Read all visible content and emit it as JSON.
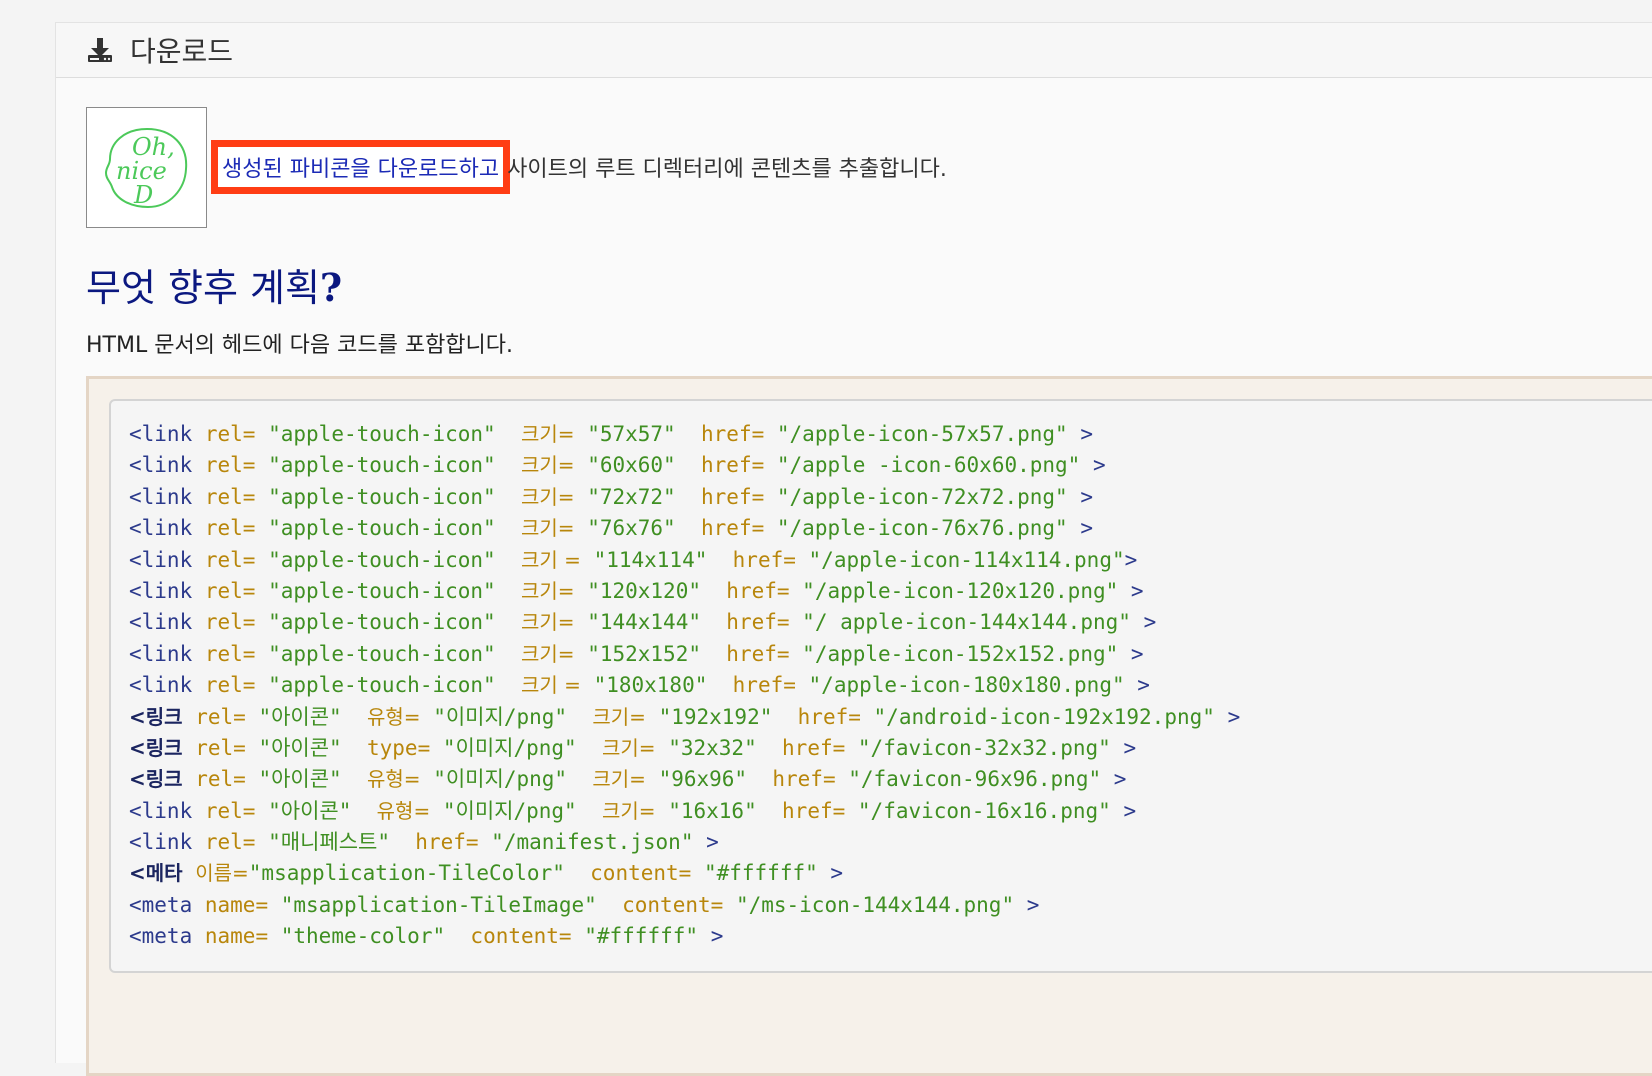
{
  "header": {
    "icon": "download-icon",
    "title": "다운로드"
  },
  "intro": {
    "link_text": "생성된 파비콘을 다운로드하고",
    "rest_text": " 사이트의 루트 디렉터리에 콘텐츠를 추출합니다."
  },
  "favicon_preview": {
    "icon": "oh-nice-d-logo",
    "logo_text": "Oh, nice D",
    "color": "#4cc95a"
  },
  "section": {
    "heading": "무엇 향후 계획",
    "heading_mark": "?",
    "description": "HTML 문서의 헤드에 다음 코드를 포함합니다."
  },
  "code_lines": [
    [
      [
        "tg",
        "<link"
      ],
      [
        "sp",
        " "
      ],
      [
        "at",
        "rel="
      ],
      [
        "sp",
        " "
      ],
      [
        "vl",
        "\"apple-touch-icon\""
      ],
      [
        "sp",
        "  "
      ],
      [
        "atk",
        "크기="
      ],
      [
        "sp",
        " "
      ],
      [
        "vl",
        "\"57x57\""
      ],
      [
        "sp",
        "  "
      ],
      [
        "at",
        "href="
      ],
      [
        "sp",
        " "
      ],
      [
        "vl",
        "\"/apple-icon-57x57.png\""
      ],
      [
        "sp",
        " "
      ],
      [
        "br",
        ">"
      ]
    ],
    [
      [
        "tg",
        "<link"
      ],
      [
        "sp",
        " "
      ],
      [
        "at",
        "rel="
      ],
      [
        "sp",
        " "
      ],
      [
        "vl",
        "\"apple-touch-icon\""
      ],
      [
        "sp",
        "  "
      ],
      [
        "atk",
        "크기="
      ],
      [
        "sp",
        " "
      ],
      [
        "vl",
        "\"60x60\""
      ],
      [
        "sp",
        "  "
      ],
      [
        "at",
        "href="
      ],
      [
        "sp",
        " "
      ],
      [
        "vl",
        "\"/apple -icon-60x60.png\""
      ],
      [
        "sp",
        " "
      ],
      [
        "br",
        ">"
      ]
    ],
    [
      [
        "tg",
        "<link"
      ],
      [
        "sp",
        " "
      ],
      [
        "at",
        "rel="
      ],
      [
        "sp",
        " "
      ],
      [
        "vl",
        "\"apple-touch-icon\""
      ],
      [
        "sp",
        "  "
      ],
      [
        "atk",
        "크기="
      ],
      [
        "sp",
        " "
      ],
      [
        "vl",
        "\"72x72\""
      ],
      [
        "sp",
        "  "
      ],
      [
        "at",
        "href="
      ],
      [
        "sp",
        " "
      ],
      [
        "vl",
        "\"/apple-icon-72x72.png\""
      ],
      [
        "sp",
        " "
      ],
      [
        "br",
        ">"
      ]
    ],
    [
      [
        "tg",
        "<link"
      ],
      [
        "sp",
        " "
      ],
      [
        "at",
        "rel="
      ],
      [
        "sp",
        " "
      ],
      [
        "vl",
        "\"apple-touch-icon\""
      ],
      [
        "sp",
        "  "
      ],
      [
        "atk",
        "크기="
      ],
      [
        "sp",
        " "
      ],
      [
        "vl",
        "\"76x76\""
      ],
      [
        "sp",
        "  "
      ],
      [
        "at",
        "href="
      ],
      [
        "sp",
        " "
      ],
      [
        "vl",
        "\"/apple-icon-76x76.png\""
      ],
      [
        "sp",
        " "
      ],
      [
        "br",
        ">"
      ]
    ],
    [
      [
        "tg",
        "<link"
      ],
      [
        "sp",
        " "
      ],
      [
        "at",
        "rel="
      ],
      [
        "sp",
        " "
      ],
      [
        "vl",
        "\"apple-touch-icon\""
      ],
      [
        "sp",
        "  "
      ],
      [
        "atk",
        "크기 ="
      ],
      [
        "sp",
        " "
      ],
      [
        "vl",
        "\"114x114\""
      ],
      [
        "sp",
        "  "
      ],
      [
        "at",
        "href="
      ],
      [
        "sp",
        " "
      ],
      [
        "vl",
        "\"/apple-icon-114x114.png\""
      ],
      [
        "br",
        ">"
      ]
    ],
    [
      [
        "tg",
        "<link"
      ],
      [
        "sp",
        " "
      ],
      [
        "at",
        "rel="
      ],
      [
        "sp",
        " "
      ],
      [
        "vl",
        "\"apple-touch-icon\""
      ],
      [
        "sp",
        "  "
      ],
      [
        "atk",
        "크기="
      ],
      [
        "sp",
        " "
      ],
      [
        "vl",
        "\"120x120\""
      ],
      [
        "sp",
        "  "
      ],
      [
        "at",
        "href="
      ],
      [
        "sp",
        " "
      ],
      [
        "vl",
        "\"/apple-icon-120x120.png\""
      ],
      [
        "sp",
        " "
      ],
      [
        "br",
        ">"
      ]
    ],
    [
      [
        "tg",
        "<link"
      ],
      [
        "sp",
        " "
      ],
      [
        "at",
        "rel="
      ],
      [
        "sp",
        " "
      ],
      [
        "vl",
        "\"apple-touch-icon\""
      ],
      [
        "sp",
        "  "
      ],
      [
        "atk",
        "크기="
      ],
      [
        "sp",
        " "
      ],
      [
        "vl",
        "\"144x144\""
      ],
      [
        "sp",
        "  "
      ],
      [
        "at",
        "href="
      ],
      [
        "sp",
        " "
      ],
      [
        "vl",
        "\"/ apple-icon-144x144.png\""
      ],
      [
        "sp",
        " "
      ],
      [
        "br",
        ">"
      ]
    ],
    [
      [
        "tg",
        "<link"
      ],
      [
        "sp",
        " "
      ],
      [
        "at",
        "rel="
      ],
      [
        "sp",
        " "
      ],
      [
        "vl",
        "\"apple-touch-icon\""
      ],
      [
        "sp",
        "  "
      ],
      [
        "atk",
        "크기="
      ],
      [
        "sp",
        " "
      ],
      [
        "vl",
        "\"152x152\""
      ],
      [
        "sp",
        "  "
      ],
      [
        "at",
        "href="
      ],
      [
        "sp",
        " "
      ],
      [
        "vl",
        "\"/apple-icon-152x152.png\""
      ],
      [
        "sp",
        " "
      ],
      [
        "br",
        ">"
      ]
    ],
    [
      [
        "tg",
        "<link"
      ],
      [
        "sp",
        " "
      ],
      [
        "at",
        "rel="
      ],
      [
        "sp",
        " "
      ],
      [
        "vl",
        "\"apple-touch-icon\""
      ],
      [
        "sp",
        "  "
      ],
      [
        "atk",
        "크기 ="
      ],
      [
        "sp",
        " "
      ],
      [
        "vl",
        "\"180x180\""
      ],
      [
        "sp",
        "  "
      ],
      [
        "at",
        "href="
      ],
      [
        "sp",
        " "
      ],
      [
        "vl",
        "\"/apple-icon-180x180.png\""
      ],
      [
        "sp",
        " "
      ],
      [
        "br",
        ">"
      ]
    ],
    [
      [
        "tgk",
        "<링크"
      ],
      [
        "sp",
        " "
      ],
      [
        "at",
        "rel="
      ],
      [
        "sp",
        " "
      ],
      [
        "vl",
        "\"아이콘\""
      ],
      [
        "sp",
        "  "
      ],
      [
        "atk",
        "유형="
      ],
      [
        "sp",
        " "
      ],
      [
        "vl",
        "\"이미지/png\""
      ],
      [
        "sp",
        "  "
      ],
      [
        "atk",
        "크기="
      ],
      [
        "sp",
        " "
      ],
      [
        "vl",
        "\"192x192\""
      ],
      [
        "sp",
        "  "
      ],
      [
        "at",
        "href="
      ],
      [
        "sp",
        " "
      ],
      [
        "vl",
        "\"/android-icon-192x192.png\""
      ],
      [
        "sp",
        " "
      ],
      [
        "br",
        ">"
      ]
    ],
    [
      [
        "tgk",
        "<링크"
      ],
      [
        "sp",
        " "
      ],
      [
        "at",
        "rel="
      ],
      [
        "sp",
        " "
      ],
      [
        "vl",
        "\"아이콘\""
      ],
      [
        "sp",
        "  "
      ],
      [
        "at",
        "type="
      ],
      [
        "sp",
        " "
      ],
      [
        "vl",
        "\"이미지/png\""
      ],
      [
        "sp",
        "  "
      ],
      [
        "atk",
        "크기="
      ],
      [
        "sp",
        " "
      ],
      [
        "vl",
        "\"32x32\""
      ],
      [
        "sp",
        "  "
      ],
      [
        "at",
        "href="
      ],
      [
        "sp",
        " "
      ],
      [
        "vl",
        "\"/favicon-32x32.png\""
      ],
      [
        "sp",
        " "
      ],
      [
        "br",
        ">"
      ]
    ],
    [
      [
        "tgk",
        "<링크"
      ],
      [
        "sp",
        " "
      ],
      [
        "at",
        "rel="
      ],
      [
        "sp",
        " "
      ],
      [
        "vl",
        "\"아이콘\""
      ],
      [
        "sp",
        "  "
      ],
      [
        "atk",
        "유형="
      ],
      [
        "sp",
        " "
      ],
      [
        "vl",
        "\"이미지/png\""
      ],
      [
        "sp",
        "  "
      ],
      [
        "atk",
        "크기="
      ],
      [
        "sp",
        " "
      ],
      [
        "vl",
        "\"96x96\""
      ],
      [
        "sp",
        "  "
      ],
      [
        "at",
        "href="
      ],
      [
        "sp",
        " "
      ],
      [
        "vl",
        "\"/favicon-96x96.png\""
      ],
      [
        "sp",
        " "
      ],
      [
        "br",
        ">"
      ]
    ],
    [
      [
        "tg",
        "<link"
      ],
      [
        "sp",
        " "
      ],
      [
        "at",
        "rel="
      ],
      [
        "sp",
        " "
      ],
      [
        "vl",
        "\"아이콘\""
      ],
      [
        "sp",
        "  "
      ],
      [
        "atk",
        "유형="
      ],
      [
        "sp",
        " "
      ],
      [
        "vl",
        "\"이미지/png\""
      ],
      [
        "sp",
        "  "
      ],
      [
        "atk",
        "크기="
      ],
      [
        "sp",
        " "
      ],
      [
        "vl",
        "\"16x16\""
      ],
      [
        "sp",
        "  "
      ],
      [
        "at",
        "href="
      ],
      [
        "sp",
        " "
      ],
      [
        "vl",
        "\"/favicon-16x16.png\""
      ],
      [
        "sp",
        " "
      ],
      [
        "br",
        ">"
      ]
    ],
    [
      [
        "tg",
        "<link"
      ],
      [
        "sp",
        " "
      ],
      [
        "at",
        "rel="
      ],
      [
        "sp",
        " "
      ],
      [
        "vl",
        "\"매니페스트\""
      ],
      [
        "sp",
        "  "
      ],
      [
        "at",
        "href="
      ],
      [
        "sp",
        " "
      ],
      [
        "vl",
        "\"/manifest.json\""
      ],
      [
        "sp",
        " "
      ],
      [
        "br",
        ">"
      ]
    ],
    [
      [
        "tgk",
        "<메타"
      ],
      [
        "sp",
        " "
      ],
      [
        "atk",
        "이름="
      ],
      [
        "vl",
        "\"msapplication-TileColor\""
      ],
      [
        "sp",
        "  "
      ],
      [
        "at",
        "content="
      ],
      [
        "sp",
        " "
      ],
      [
        "vl",
        "\"#ffffff\""
      ],
      [
        "sp",
        " "
      ],
      [
        "br",
        ">"
      ]
    ],
    [
      [
        "tg",
        "<meta"
      ],
      [
        "sp",
        " "
      ],
      [
        "at",
        "name="
      ],
      [
        "sp",
        " "
      ],
      [
        "vl",
        "\"msapplication-TileImage\""
      ],
      [
        "sp",
        "  "
      ],
      [
        "at",
        "content="
      ],
      [
        "sp",
        " "
      ],
      [
        "vl",
        "\"/ms-icon-144x144.png\""
      ],
      [
        "sp",
        " "
      ],
      [
        "br",
        ">"
      ]
    ],
    [
      [
        "tg",
        "<meta"
      ],
      [
        "sp",
        " "
      ],
      [
        "at",
        "name="
      ],
      [
        "sp",
        " "
      ],
      [
        "vl",
        "\"theme-color\""
      ],
      [
        "sp",
        "  "
      ],
      [
        "at",
        "content="
      ],
      [
        "sp",
        " "
      ],
      [
        "vl",
        "\"#ffffff\""
      ],
      [
        "sp",
        " "
      ],
      [
        "br",
        ">"
      ]
    ]
  ],
  "colors": {
    "highlight_border": "#ff3d14",
    "link": "#1c2bb6",
    "heading": "#0b1880",
    "code_tag": "#2c3a8c",
    "code_attr": "#b8860b",
    "code_value": "#3f8f22"
  }
}
